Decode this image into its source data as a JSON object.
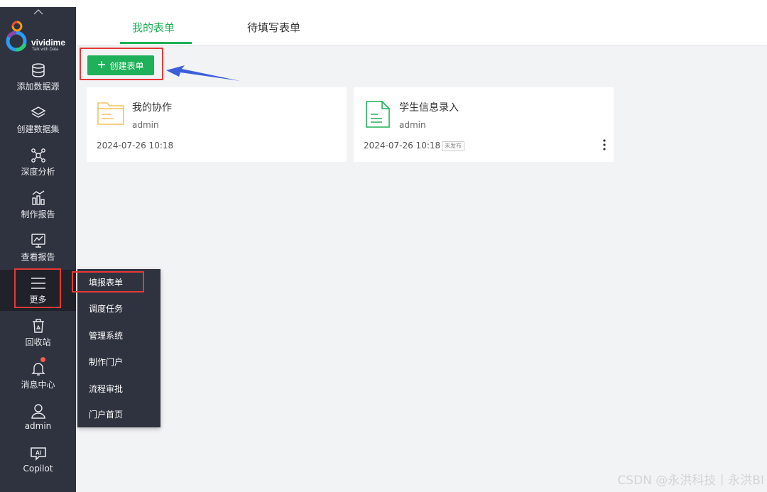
{
  "logo": {
    "name": "vividime",
    "tagline": "Talk with Data"
  },
  "sidebar": {
    "items": [
      {
        "label": "添加数据源",
        "icon": "database-icon"
      },
      {
        "label": "创建数据集",
        "icon": "layers-icon"
      },
      {
        "label": "深度分析",
        "icon": "network-icon"
      },
      {
        "label": "制作报告",
        "icon": "bar-chart-icon"
      },
      {
        "label": "查看报告",
        "icon": "monitor-chart-icon"
      },
      {
        "label": "更多",
        "icon": "menu-icon"
      },
      {
        "label": "回收站",
        "icon": "trash-icon"
      },
      {
        "label": "消息中心",
        "icon": "bell-icon"
      },
      {
        "label": "admin",
        "icon": "user-icon"
      },
      {
        "label": "Copilot",
        "icon": "ai-icon"
      }
    ]
  },
  "tabs": [
    {
      "label": "我的表单",
      "active": true
    },
    {
      "label": "待填写表单",
      "active": false
    }
  ],
  "create_button": {
    "icon": "plus-icon",
    "label": "创建表单"
  },
  "cards": [
    {
      "title": "我的协作",
      "owner": "admin",
      "date": "2024-07-26 10:18",
      "icon": "folder-icon",
      "badge": ""
    },
    {
      "title": "学生信息录入",
      "owner": "admin",
      "date": "2024-07-26 10:18",
      "icon": "document-icon",
      "badge": "未发布"
    }
  ],
  "more_menu": {
    "items": [
      "填报表单",
      "调度任务",
      "管理系统",
      "制作门户",
      "流程审批",
      "门户首页"
    ]
  },
  "watermark": "CSDN @永洪科技丨永洪BI",
  "colors": {
    "accent": "#1fb159",
    "sidebar": "#2f333f",
    "highlight": "#e53935",
    "arrow": "#3a5fd9",
    "folder": "#f5c362"
  }
}
